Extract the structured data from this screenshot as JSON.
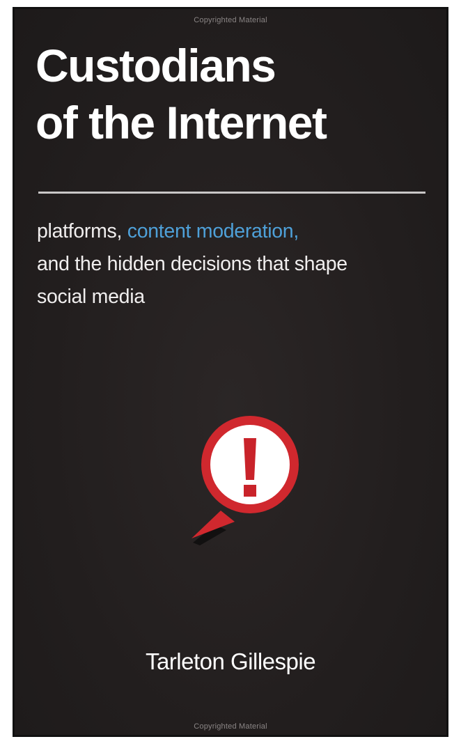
{
  "cover": {
    "copyright_top": "Copyrighted Material",
    "copyright_bottom": "Copyrighted Material",
    "title_line1": "Custodians",
    "title_line2": "of the Internet",
    "subtitle_part1": "platforms, ",
    "subtitle_accent": "content moderation,",
    "subtitle_line2": "and the hidden decisions that shape",
    "subtitle_line3": "social media",
    "author": "Tarleton Gillespie"
  },
  "colors": {
    "background": "#231f1f",
    "title": "#ffffff",
    "accent": "#4ea0d8",
    "icon_red": "#d0282e",
    "icon_white": "#ffffff"
  },
  "icons": {
    "alert": "exclamation-speech-bubble-icon"
  }
}
